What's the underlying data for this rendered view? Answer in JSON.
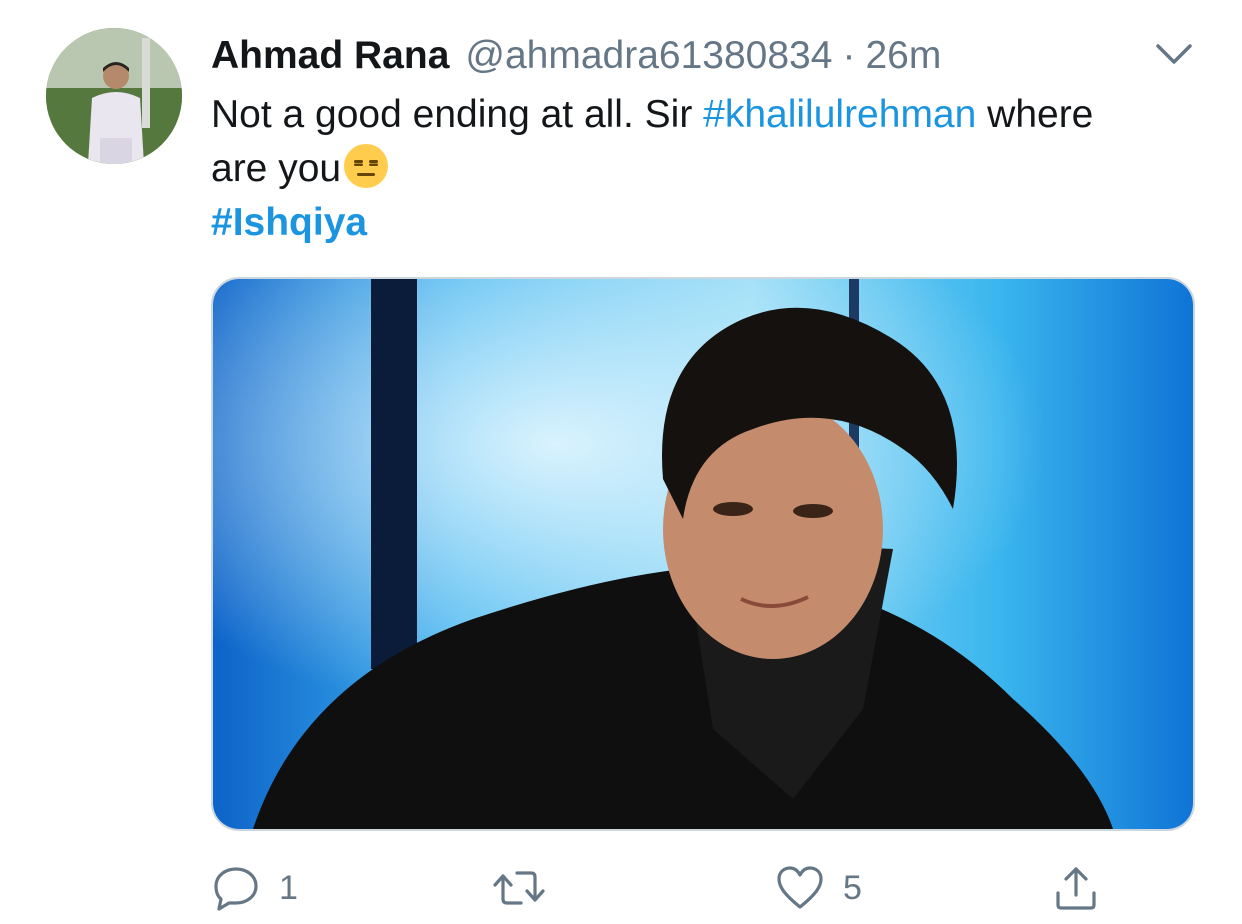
{
  "tweet": {
    "author_name": "Ahmad Rana",
    "handle": "@ahmadra61380834",
    "separator": "·",
    "time": "26m",
    "text_line1_part1": "Not a good ending at all. Sir ",
    "text_line1_hashtag": "#khalilulrehman",
    "text_line1_part2": " where",
    "text_line2": "are you",
    "emoji": "expressionless-face",
    "hashtag_line": "#Ishqiya"
  },
  "actions": {
    "reply_count": "1",
    "retweet_count": "",
    "like_count": "5"
  },
  "icons": {
    "reply": "reply-icon",
    "retweet": "retweet-icon",
    "like": "heart-icon",
    "share": "share-icon",
    "caret": "chevron-down-icon"
  },
  "colors": {
    "link": "#1b95e0",
    "secondary_text": "#657786",
    "primary_text": "#14171a",
    "border": "#ccd6dd"
  }
}
